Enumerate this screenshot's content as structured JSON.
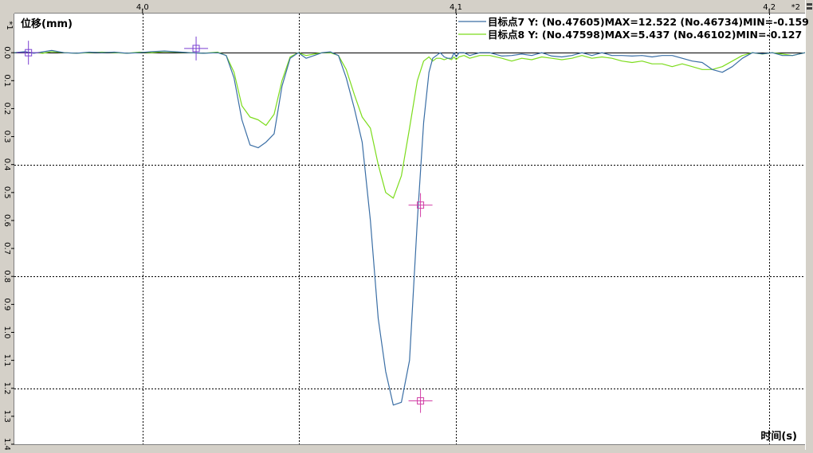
{
  "chart_data": {
    "type": "line",
    "ylabel": "位移(mm)",
    "xlabel": "时间(s)",
    "corner_y": "*1",
    "corner_x": "*2",
    "xlim": [
      3.9591,
      4.2114
    ],
    "ylim": [
      -0.14,
      1.4
    ],
    "x_ticks": [
      "4,0",
      "4,1",
      "4,2"
    ],
    "x_tick_values": [
      4.0,
      4.1,
      4.2
    ],
    "y_ticks": [
      "0.0",
      "0.1",
      "0.2",
      "0.3",
      "0.4",
      "0.5",
      "0.6",
      "0.7",
      "0.8",
      "0.9",
      "1.0",
      "1.1",
      "1.2",
      "1.3",
      "1.4"
    ],
    "y_tick_values": [
      0.0,
      0.1,
      0.2,
      0.3,
      0.4,
      0.5,
      0.6,
      0.7,
      0.8,
      0.9,
      1.0,
      1.1,
      1.2,
      1.3,
      1.4
    ],
    "v_grid": [
      4.0,
      4.05,
      4.1,
      4.2
    ],
    "h_grid": [
      0.4,
      0.8,
      1.2
    ],
    "zero_line": 0.0,
    "grid": true,
    "legend_placement": "top-right",
    "series": [
      {
        "name": "目标点7",
        "legend_text": "目标点7 Y: (No.47605)MAX=12.522  (No.46734)MIN=-0.159",
        "color": "#3a6ea5",
        "x": [
          3.9591,
          3.9625,
          3.9653,
          3.9682,
          3.971,
          3.975,
          3.979,
          3.983,
          3.987,
          3.991,
          3.995,
          3.999,
          4.003,
          4.007,
          4.011,
          4.015,
          4.0195,
          4.024,
          4.0267,
          4.0292,
          4.0317,
          4.0343,
          4.0369,
          4.0394,
          4.042,
          4.0445,
          4.0471,
          4.0497,
          4.0522,
          4.0548,
          4.0573,
          4.0599,
          4.0625,
          4.065,
          4.0676,
          4.0701,
          4.0727,
          4.0752,
          4.0776,
          4.08,
          4.0826,
          4.0852,
          4.0877,
          4.0897,
          4.0914,
          4.0926,
          4.0938,
          4.095,
          4.0963,
          4.0974,
          4.0986,
          4.0994,
          4.1001,
          4.101,
          4.1026,
          4.1044,
          4.1076,
          4.1108,
          4.1147,
          4.1178,
          4.121,
          4.1242,
          4.1274,
          4.1306,
          4.1338,
          4.137,
          4.1402,
          4.1434,
          4.1466,
          4.1498,
          4.153,
          4.1562,
          4.1594,
          4.1626,
          4.1658,
          4.169,
          4.1722,
          4.1754,
          4.1786,
          4.1818,
          4.185,
          4.1882,
          4.1914,
          4.1946,
          4.1978,
          4.201,
          4.2042,
          4.2074,
          4.2114
        ],
        "y": [
          0.0,
          -0.004,
          0.002,
          -0.003,
          -0.008,
          0.0,
          0.002,
          -0.002,
          0.0,
          -0.002,
          0.002,
          0.0,
          -0.004,
          -0.006,
          -0.003,
          0.0,
          0.002,
          0.0,
          0.01,
          0.09,
          0.24,
          0.33,
          0.34,
          0.32,
          0.29,
          0.12,
          0.02,
          0.0,
          0.02,
          0.01,
          0.0,
          -0.003,
          0.01,
          0.09,
          0.2,
          0.32,
          0.6,
          0.95,
          1.14,
          1.26,
          1.25,
          1.1,
          0.6,
          0.25,
          0.07,
          0.02,
          0.01,
          0.0,
          0.015,
          0.02,
          0.02,
          0.0,
          0.015,
          0.0,
          0.0,
          0.01,
          0.0,
          0.0,
          0.012,
          0.01,
          0.005,
          0.01,
          0.0,
          0.012,
          0.015,
          0.01,
          0.0,
          0.01,
          0.0,
          0.01,
          0.01,
          0.012,
          0.01,
          0.015,
          0.01,
          0.01,
          0.02,
          0.03,
          0.035,
          0.06,
          0.07,
          0.05,
          0.02,
          0.0,
          0.004,
          0.0,
          0.01,
          0.01,
          0.0
        ]
      },
      {
        "name": "目标点8",
        "legend_text": "目标点8 Y: (No.47598)MAX=5.437  (No.46102)MIN=-0.127",
        "color": "#7cdc1c",
        "x": [
          3.9591,
          3.9625,
          3.9653,
          3.9682,
          3.971,
          3.975,
          3.979,
          3.983,
          3.987,
          3.991,
          3.995,
          3.999,
          4.003,
          4.007,
          4.011,
          4.015,
          4.0195,
          4.024,
          4.0267,
          4.0292,
          4.0317,
          4.0343,
          4.0369,
          4.0394,
          4.042,
          4.0445,
          4.0471,
          4.0497,
          4.0522,
          4.0548,
          4.0573,
          4.0599,
          4.0625,
          4.065,
          4.0676,
          4.0701,
          4.0727,
          4.0752,
          4.0776,
          4.08,
          4.0826,
          4.0852,
          4.0877,
          4.0897,
          4.0914,
          4.0926,
          4.0938,
          4.095,
          4.0963,
          4.0974,
          4.0986,
          4.0994,
          4.1001,
          4.101,
          4.1026,
          4.1044,
          4.1076,
          4.1108,
          4.1147,
          4.1178,
          4.121,
          4.1242,
          4.1274,
          4.1306,
          4.1338,
          4.137,
          4.1402,
          4.1434,
          4.1466,
          4.1498,
          4.153,
          4.1562,
          4.1594,
          4.1626,
          4.1658,
          4.169,
          4.1722,
          4.1754,
          4.1786,
          4.1818,
          4.185,
          4.1882,
          4.1914,
          4.1946,
          4.1978,
          4.201,
          4.2042,
          4.2074,
          4.2114
        ],
        "y": [
          0.0,
          -0.002,
          0.0,
          0.002,
          -0.004,
          0.0,
          0.002,
          0.0,
          -0.002,
          0.0,
          0.002,
          -0.002,
          0.0,
          -0.004,
          -0.002,
          0.0,
          0.002,
          -0.002,
          0.01,
          0.07,
          0.19,
          0.23,
          0.24,
          0.26,
          0.22,
          0.1,
          0.015,
          0.0,
          0.01,
          0.005,
          0.0,
          0.0,
          0.01,
          0.06,
          0.15,
          0.23,
          0.27,
          0.4,
          0.5,
          0.52,
          0.44,
          0.27,
          0.1,
          0.03,
          0.015,
          0.03,
          0.02,
          0.02,
          0.025,
          0.02,
          0.025,
          0.015,
          0.025,
          0.015,
          0.01,
          0.02,
          0.01,
          0.01,
          0.02,
          0.03,
          0.02,
          0.025,
          0.015,
          0.02,
          0.025,
          0.02,
          0.01,
          0.02,
          0.015,
          0.02,
          0.03,
          0.035,
          0.03,
          0.04,
          0.04,
          0.05,
          0.04,
          0.05,
          0.06,
          0.06,
          0.05,
          0.03,
          0.01,
          0.0,
          0.005,
          0.0,
          0.005,
          0.01,
          0.0
        ]
      }
    ],
    "markers": [
      {
        "series": "目标点7",
        "x": 3.9636,
        "y": 0.0,
        "color": "#7a3fd2"
      },
      {
        "series": "目标点8",
        "x": 4.0171,
        "y": -0.015,
        "color": "#7a3fd2"
      },
      {
        "series": "目标点8",
        "x": 4.0887,
        "y": 0.545,
        "color": "#d23fa6"
      },
      {
        "series": "目标点7",
        "x": 4.0887,
        "y": 1.245,
        "color": "#d23fa6"
      }
    ]
  }
}
